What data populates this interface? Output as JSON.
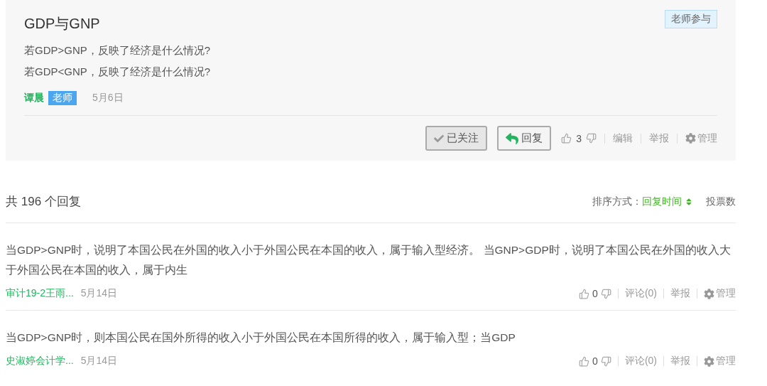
{
  "question": {
    "title": "GDP与GNP",
    "badge": "老师参与",
    "lines": [
      "若GDP>GNP，反映了经济是什么情况?",
      "若GDP<GNP，反映了经济是什么情况?"
    ],
    "author": "谭晨",
    "role": "老师",
    "date": "5月6日",
    "follow_button": {
      "label": "已关注",
      "followed": true
    },
    "reply_button": "回复",
    "likes": "3",
    "actions": [
      {
        "label": "编辑",
        "kind": "link"
      },
      {
        "label": "举报",
        "kind": "link"
      },
      {
        "label": "管理",
        "kind": "manage"
      }
    ]
  },
  "replies_header": {
    "count": "共 196 个回复",
    "sort_label": "排序方式：",
    "sort_options": [
      {
        "label": "回复时间",
        "selected": true
      },
      {
        "label": "投票数",
        "selected": false
      }
    ]
  },
  "replies": [
    {
      "text": "当GDP>GNP时，说明了本国公民在外国的收入小于外国公民在本国的收入，属于输入型经济。 当GNP>GDP时，说明了本国公民在外国的收入大于外国公民在本国的收入，属于内生",
      "author": "审计19-2王雨...",
      "date": "5月14日",
      "likes": "0",
      "actions": [
        {
          "label": "评论(0)",
          "kind": "link"
        },
        {
          "label": "举报",
          "kind": "link"
        },
        {
          "label": "管理",
          "kind": "manage"
        }
      ]
    },
    {
      "text": "当GDP>GNP时，则本国公民在国外所得的收入小于外国公民在本国所得的收入，属于输入型；当GDP",
      "author": "史淑婷会计学...",
      "date": "5月14日",
      "likes": "0",
      "actions": [
        {
          "label": "评论(0)",
          "kind": "link"
        },
        {
          "label": "举报",
          "kind": "link"
        },
        {
          "label": "管理",
          "kind": "manage"
        }
      ]
    }
  ]
}
